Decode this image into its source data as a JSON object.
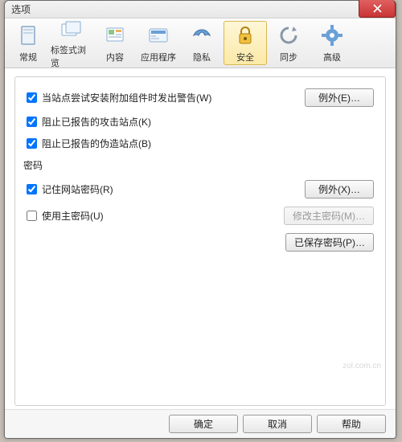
{
  "window": {
    "title": "选项"
  },
  "tabs": [
    {
      "label": "常规"
    },
    {
      "label": "标签式浏览"
    },
    {
      "label": "内容"
    },
    {
      "label": "应用程序"
    },
    {
      "label": "隐私"
    },
    {
      "label": "安全",
      "selected": true
    },
    {
      "label": "同步"
    },
    {
      "label": "高级"
    }
  ],
  "security": {
    "check_addon_install": {
      "label": "当站点尝试安装附加组件时发出警告(W)",
      "checked": true
    },
    "block_attack": {
      "label": "阻止已报告的攻击站点(K)",
      "checked": true
    },
    "block_forgery": {
      "label": "阻止已报告的伪造站点(B)",
      "checked": true
    },
    "exceptions_btn": "例外(E)…"
  },
  "passwords": {
    "section_label": "密码",
    "remember": {
      "label": "记住网站密码(R)",
      "checked": true
    },
    "use_master": {
      "label": "使用主密码(U)",
      "checked": false
    },
    "exceptions_btn": "例外(X)…",
    "change_master_btn": "修改主密码(M)…",
    "saved_btn": "已保存密码(P)…"
  },
  "footer": {
    "ok": "确定",
    "cancel": "取消",
    "help": "帮助"
  },
  "watermark": "zol.com.cn"
}
